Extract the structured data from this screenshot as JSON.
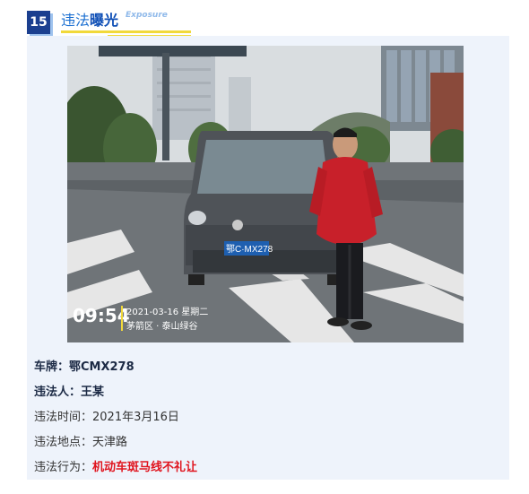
{
  "header": {
    "number": "15",
    "title_plain": "违法",
    "title_strong": "曝光",
    "title_en": "Exposure"
  },
  "photo": {
    "time": "09:54",
    "date_line": "2021-03-16 星期二",
    "place_line": "茅箭区 · 泰山绿谷",
    "plate_on_car": "鄂C·MX278"
  },
  "info": {
    "plate_label": "车牌：",
    "plate_value": "鄂CMX278",
    "person_label": "违法人：",
    "person_value": "王某",
    "time_label": "违法时间：",
    "time_value": "2021年3月16日",
    "place_label": "违法地点：",
    "place_value": "天津路",
    "behavior_label": "违法行为：",
    "behavior_value": "机动车斑马线不礼让"
  },
  "colors": {
    "accent": "#1b3f8f",
    "highlight": "#f1d93b",
    "violation": "#e0141e",
    "card_bg": "#eef3fb"
  }
}
